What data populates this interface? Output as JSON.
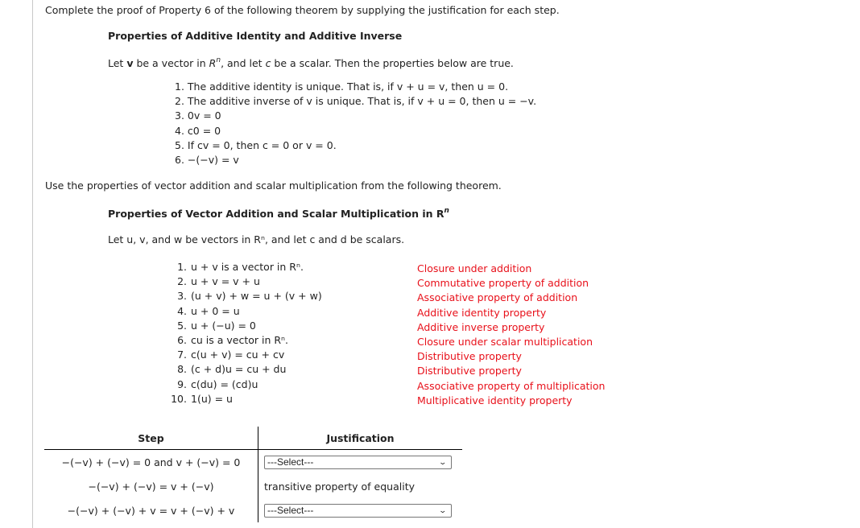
{
  "instruction": "Complete the proof of Property 6 of the following theorem by supplying the justification for each step.",
  "theorem1": {
    "title": "Properties of Additive Identity and Additive Inverse",
    "intro_parts": [
      "Let ",
      "v",
      " be a vector in ",
      "R",
      "n",
      ", and let ",
      "c",
      " be a scalar. Then the properties below are true."
    ],
    "items": [
      "1. The additive identity is unique. That is, if v + u = v, then u = 0.",
      "2. The additive inverse of v is unique. That is, if v + u = 0, then u = −v.",
      "3. 0v = 0",
      "4. c0 = 0",
      "5. If cv = 0, then c = 0 or v = 0.",
      "6. −(−v) = v"
    ]
  },
  "use_text": "Use the properties of vector addition and scalar multiplication from the following theorem.",
  "theorem2": {
    "title": "Properties of Vector Addition and Scalar Multiplication in R",
    "title_sup": "n",
    "intro": "Let u, v, and w be vectors in Rⁿ, and let c and d be scalars.",
    "items": [
      {
        "n": "1.",
        "expr": "u + v is a vector in Rⁿ.",
        "name": "Closure under addition"
      },
      {
        "n": "2.",
        "expr": "u + v = v + u",
        "name": "Commutative property of addition"
      },
      {
        "n": "3.",
        "expr": "(u + v) + w = u + (v + w)",
        "name": "Associative property of addition"
      },
      {
        "n": "4.",
        "expr": "u + 0 = u",
        "name": "Additive identity property"
      },
      {
        "n": "5.",
        "expr": "u + (−u) = 0",
        "name": "Additive inverse property"
      },
      {
        "n": "6.",
        "expr": "cu is a vector in Rⁿ.",
        "name": "Closure under scalar multiplication"
      },
      {
        "n": "7.",
        "expr": "c(u + v) = cu + cv",
        "name": "Distributive property"
      },
      {
        "n": "8.",
        "expr": "(c + d)u = cu + du",
        "name": "Distributive property"
      },
      {
        "n": "9.",
        "expr": "c(du) = (cd)u",
        "name": "Associative property of multiplication"
      },
      {
        "n": "10.",
        "expr": "1(u) = u",
        "name": "Multiplicative identity property"
      }
    ]
  },
  "proof_table": {
    "headers": [
      "Step",
      "Justification"
    ],
    "rows": [
      {
        "step": "−(−v) + (−v) = 0 and v + (−v) = 0",
        "justification": "---Select---",
        "type": "select"
      },
      {
        "step": "−(−v) + (−v) = v + (−v)",
        "justification": "transitive property of equality",
        "type": "text"
      },
      {
        "step": "−(−v) + (−v) + v = v + (−v) + v",
        "justification": "---Select---",
        "type": "select"
      }
    ]
  },
  "colors": {
    "property_names": "#e8101a",
    "text": "#222222"
  }
}
